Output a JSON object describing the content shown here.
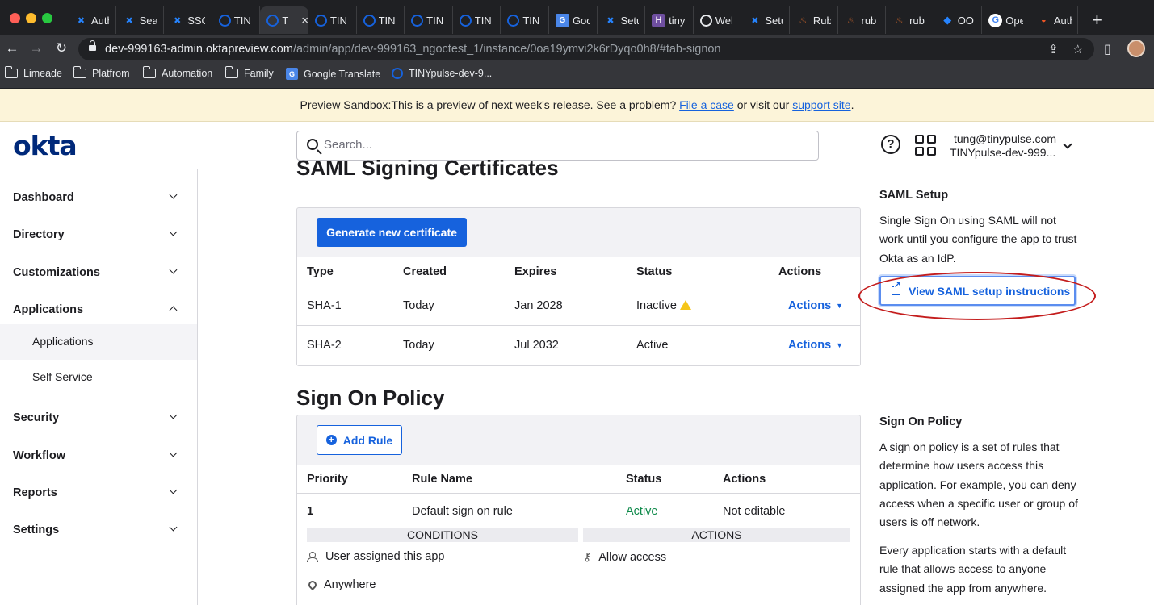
{
  "browser": {
    "tabs": [
      {
        "icon": "confluence-icon",
        "title": "Auth"
      },
      {
        "icon": "confluence-icon",
        "title": "Sea"
      },
      {
        "icon": "confluence-icon",
        "title": "SSO"
      },
      {
        "icon": "okta-ring-icon",
        "title": "TIN"
      },
      {
        "icon": "okta-ring-icon",
        "title": "T",
        "active": true
      },
      {
        "icon": "okta-ring-icon",
        "title": "TIN"
      },
      {
        "icon": "okta-ring-icon",
        "title": "TIN"
      },
      {
        "icon": "okta-ring-icon",
        "title": "TIN"
      },
      {
        "icon": "okta-ring-icon",
        "title": "TIN"
      },
      {
        "icon": "okta-ring-icon",
        "title": "TIN"
      },
      {
        "icon": "google-translate-icon",
        "title": "Goo"
      },
      {
        "icon": "confluence-icon",
        "title": "Setu"
      },
      {
        "icon": "h-icon",
        "title": "tiny"
      },
      {
        "icon": "web-icon",
        "title": "Wel"
      },
      {
        "icon": "confluence-icon",
        "title": "Setu"
      },
      {
        "icon": "ruby-icon",
        "title": "Rub"
      },
      {
        "icon": "ruby-icon",
        "title": "rub"
      },
      {
        "icon": "ruby-icon",
        "title": "rub"
      },
      {
        "icon": "ooo-icon",
        "title": "OO"
      },
      {
        "icon": "google-icon",
        "title": "Ope"
      },
      {
        "icon": "auth0-icon",
        "title": "Auth"
      }
    ],
    "url_host": "dev-999163-admin.oktapreview.com",
    "url_path": "/admin/app/dev-999163_ngoctest_1/instance/0oa19ymvi2k6rDyqo0h8/#tab-signon",
    "bookmarks": [
      {
        "type": "folder",
        "label": "Limeade"
      },
      {
        "type": "folder",
        "label": "Platfrom"
      },
      {
        "type": "folder",
        "label": "Automation"
      },
      {
        "type": "folder",
        "label": "Family"
      },
      {
        "type": "link",
        "icon": "google-translate-icon",
        "label": "Google Translate"
      },
      {
        "type": "link",
        "icon": "okta-ring-icon",
        "label": "TINYpulse-dev-9..."
      }
    ]
  },
  "banner": {
    "text": "Preview Sandbox:This is a preview of next week's release. See a problem?",
    "link1": "File a case",
    "middle": "or visit our",
    "link2": "support site",
    "end": "."
  },
  "header": {
    "logo": "okta",
    "search_placeholder": "Search...",
    "user_email": "tung@tinypulse.com",
    "user_org": "TINYpulse-dev-999..."
  },
  "sidebar": {
    "items": [
      {
        "label": "Dashboard"
      },
      {
        "label": "Directory"
      },
      {
        "label": "Customizations"
      },
      {
        "label": "Applications",
        "expanded": true
      },
      {
        "label": "Security"
      },
      {
        "label": "Workflow"
      },
      {
        "label": "Reports"
      },
      {
        "label": "Settings"
      }
    ],
    "sub_items": [
      {
        "label": "Applications",
        "active": true
      },
      {
        "label": "Self Service"
      }
    ]
  },
  "certificates": {
    "title": "SAML Signing Certificates",
    "generate_button": "Generate new certificate",
    "columns": [
      "Type",
      "Created",
      "Expires",
      "Status",
      "Actions"
    ],
    "rows": [
      {
        "type": "SHA-1",
        "created": "Today",
        "expires": "Jan 2028",
        "status": "Inactive",
        "warning": true,
        "actions": "Actions"
      },
      {
        "type": "SHA-2",
        "created": "Today",
        "expires": "Jul 2032",
        "status": "Active",
        "warning": false,
        "actions": "Actions"
      }
    ]
  },
  "policy": {
    "title": "Sign On Policy",
    "add_rule_button": "Add Rule",
    "columns": [
      "Priority",
      "Rule Name",
      "Status",
      "Actions"
    ],
    "rows": [
      {
        "priority": "1",
        "rule_name": "Default sign on rule",
        "status": "Active",
        "actions": "Not editable"
      }
    ],
    "conditions_label": "CONDITIONS",
    "actions_label": "ACTIONS",
    "conditions": [
      "User assigned this app",
      "Anywhere"
    ],
    "actions_items": [
      "Allow access"
    ]
  },
  "aside": {
    "saml_setup_heading": "SAML Setup",
    "saml_setup_text": "Single Sign On using SAML will not work until you configure the app to trust Okta as an IdP.",
    "saml_button": "View SAML setup instructions",
    "policy_heading": "Sign On Policy",
    "policy_text1": "A sign on policy is a set of rules that determine how users access this application. For example, you can deny access when a specific user or group of users is off network.",
    "policy_text2": "Every application starts with a default rule that allows access to anyone assigned the app from anywhere."
  },
  "colors": {
    "okta_blue": "#1662dd",
    "okta_navy": "#00297a",
    "active_green": "#0f8a4b",
    "banner_bg": "#fcf4d9",
    "annotation_red": "#c41d1d"
  }
}
